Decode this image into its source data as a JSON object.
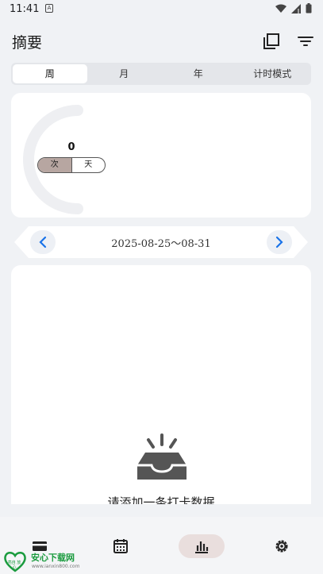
{
  "status_bar": {
    "time": "11:41",
    "notification": "A"
  },
  "app_bar": {
    "title": "摘要"
  },
  "tabs": [
    {
      "label": "周",
      "active": true
    },
    {
      "label": "月",
      "active": false
    },
    {
      "label": "年",
      "active": false
    },
    {
      "label": "计时模式",
      "active": false
    }
  ],
  "summary": {
    "count": "0",
    "units": [
      {
        "label": "次",
        "active": true
      },
      {
        "label": "天",
        "active": false
      }
    ]
  },
  "date_nav": {
    "range": "2025-08-25～08-31"
  },
  "empty_state": {
    "message": "请添加一条打卡数据"
  },
  "bottom_nav": [
    {
      "icon": "card-icon",
      "active": false
    },
    {
      "icon": "calendar-icon",
      "active": false
    },
    {
      "icon": "bar-chart-icon",
      "active": true
    },
    {
      "icon": "gear-icon",
      "active": false
    }
  ],
  "watermark": {
    "name": "安心下载网",
    "url": "www.ianxin800.com",
    "badge": "亮自 放心"
  },
  "colors": {
    "background": "#f0f2f5",
    "accent": "#1a73e8",
    "toggle_active": "#b7a6a1",
    "nav_active": "#e9dedd"
  }
}
